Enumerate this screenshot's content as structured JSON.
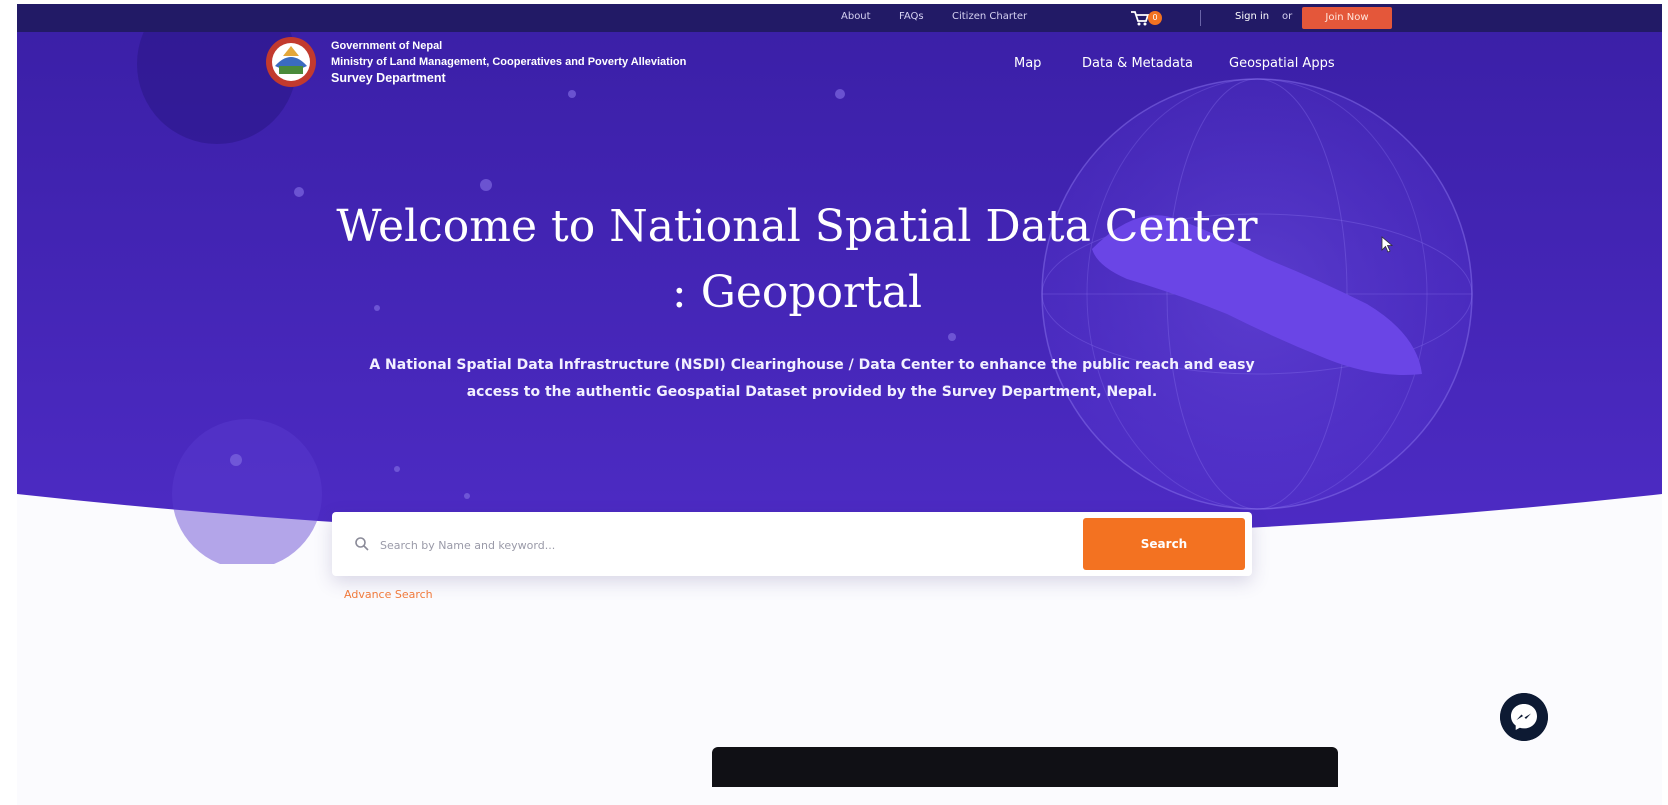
{
  "topbar": {
    "links": [
      "About",
      "FAQs",
      "Citizen Charter"
    ],
    "cart_icon": "cart-icon",
    "cart_count": "0",
    "signin": "Sign in",
    "or": "or",
    "join": "Join Now"
  },
  "header": {
    "logo_icon": "nepal-emblem-icon",
    "org_line1": "Government of Nepal",
    "org_line2": "Ministry of Land Management, Cooperatives and Poverty Alleviation",
    "org_line3": "Survey Department",
    "nav": [
      "Map",
      "Data & Metadata",
      "Geospatial Apps"
    ]
  },
  "hero": {
    "title_line1": "Welcome to National Spatial Data Center",
    "title_line2": ": Geoportal",
    "subtitle_line1": "A National Spatial Data Infrastructure (NSDI) Clearinghouse / Data Center to enhance the public reach and easy",
    "subtitle_line2": "access to the authentic Geospatial Dataset provided by the Survey Department, Nepal."
  },
  "search": {
    "placeholder": "Search by Name and keyword...",
    "button": "Search",
    "advance": "Advance Search"
  },
  "colors": {
    "hero_top": "#3a1fa6",
    "hero_bottom": "#4a2ac2",
    "accent": "#f37221",
    "topbar": "#221a66"
  },
  "icons": {
    "search": "search-icon",
    "messenger": "messenger-icon"
  }
}
